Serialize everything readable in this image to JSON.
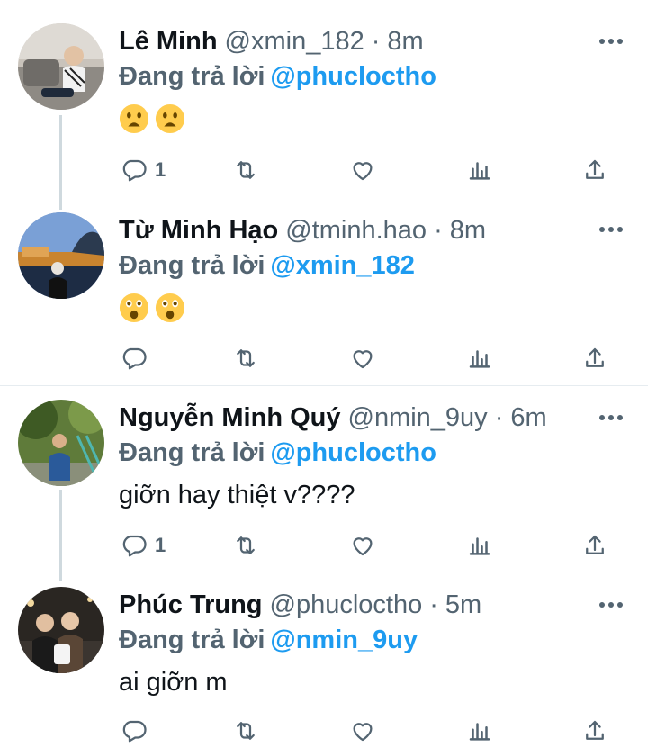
{
  "colors": {
    "link": "#1d9bf0",
    "muted": "#536471",
    "text": "#0f1419",
    "thread_line": "#cfd9de"
  },
  "tweets": [
    {
      "name": "Lê Minh",
      "handle": "@xmin_182",
      "dot": "·",
      "time": "8m",
      "replying_prefix": "Đang trả lời",
      "replying_to": "@phucloctho",
      "body": "",
      "emoji": [
        "anguished-face-emoji",
        "anguished-face-emoji"
      ],
      "reply_count": "1",
      "icons": [
        "reply-icon",
        "retweet-icon",
        "like-icon",
        "stats-icon",
        "share-icon",
        "more-icon"
      ]
    },
    {
      "name": "Từ Minh Hạo",
      "handle": "@tminh.hao",
      "dot": "·",
      "time": "8m",
      "replying_prefix": "Đang trả lời",
      "replying_to": "@xmin_182",
      "body": "",
      "emoji": [
        "astonished-face-emoji",
        "astonished-face-emoji"
      ],
      "reply_count": "",
      "icons": [
        "reply-icon",
        "retweet-icon",
        "like-icon",
        "stats-icon",
        "share-icon",
        "more-icon"
      ]
    },
    {
      "name": "Nguyễn Minh Quý",
      "handle": "@nmin_9uy",
      "dot": "·",
      "time": "6m",
      "replying_prefix": "Đang trả lời",
      "replying_to": "@phucloctho",
      "body": "giỡn hay thiệt v????",
      "reply_count": "1",
      "icons": [
        "reply-icon",
        "retweet-icon",
        "like-icon",
        "stats-icon",
        "share-icon",
        "more-icon"
      ]
    },
    {
      "name": "Phúc Trung",
      "handle": "@phucloctho",
      "dot": "·",
      "time": "5m",
      "replying_prefix": "Đang trả lời",
      "replying_to": "@nmin_9uy",
      "body": "ai giỡn m",
      "reply_count": "",
      "icons": [
        "reply-icon",
        "retweet-icon",
        "like-icon",
        "stats-icon",
        "share-icon",
        "more-icon"
      ]
    }
  ]
}
